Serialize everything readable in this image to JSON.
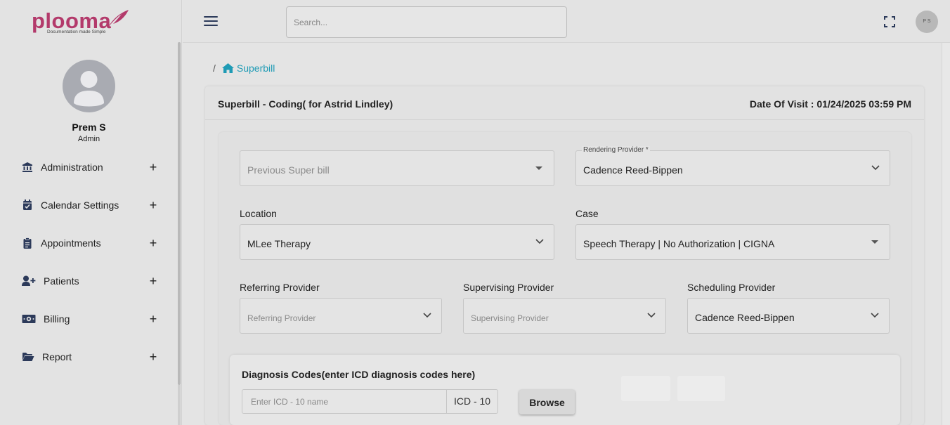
{
  "brand": {
    "name": "plooma",
    "tagline": "Documentation made Simple"
  },
  "user": {
    "name": "Prem S",
    "role": "Admin",
    "avatar_initials": "P S"
  },
  "sidebar": {
    "items": [
      {
        "label": "Administration",
        "icon": "bank-icon"
      },
      {
        "label": "Calendar Settings",
        "icon": "calendar-check-icon"
      },
      {
        "label": "Appointments",
        "icon": "clipboard-icon"
      },
      {
        "label": "Patients",
        "icon": "user-plus-icon"
      },
      {
        "label": "Billing",
        "icon": "money-icon"
      },
      {
        "label": "Report",
        "icon": "folder-open-icon"
      }
    ],
    "expand_symbol": "+"
  },
  "topbar": {
    "search_placeholder": "Search..."
  },
  "breadcrumb": {
    "separator": "/",
    "current": "Superbill"
  },
  "card": {
    "title": "Superbill - Coding( for Astrid Lindley)",
    "date_of_visit": "Date Of Visit : 01/24/2025 03:59 PM"
  },
  "form": {
    "previous_superbill": {
      "placeholder": "Previous Super bill"
    },
    "rendering_provider": {
      "label": "Rendering Provider *",
      "value": "Cadence Reed-Bippen"
    },
    "location": {
      "label": "Location",
      "value": "MLee Therapy"
    },
    "case": {
      "label": "Case",
      "value": "Speech Therapy | No Authorization | CIGNA"
    },
    "referring_provider": {
      "label": "Referring Provider",
      "placeholder": "Referring Provider"
    },
    "supervising_provider": {
      "label": "Supervising Provider",
      "placeholder": "Supervising Provider"
    },
    "scheduling_provider": {
      "label": "Scheduling Provider",
      "value": "Cadence Reed-Bippen"
    }
  },
  "diagnosis": {
    "title": "Diagnosis Codes(enter ICD diagnosis codes here)",
    "input_placeholder": "Enter ICD - 10 name",
    "addon": "ICD - 10",
    "browse_label": "Browse"
  },
  "colors": {
    "brand": "#b33a6b",
    "link": "#1f9bb5",
    "nav_icon": "#2c3a5a"
  }
}
